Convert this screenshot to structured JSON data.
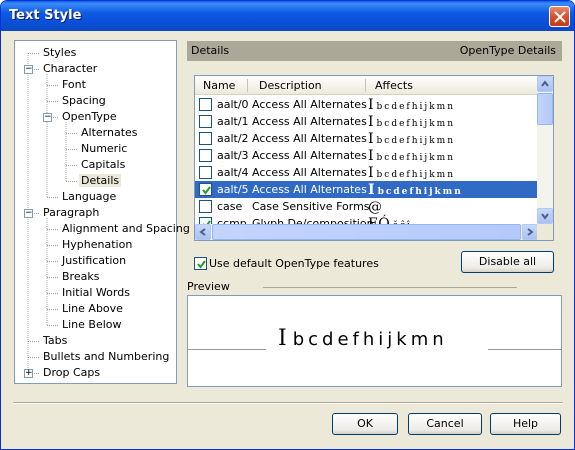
{
  "window": {
    "title": "Text Style"
  },
  "tree": {
    "items": [
      {
        "label": "Styles",
        "level": 0,
        "expander": ""
      },
      {
        "label": "Character",
        "level": 0,
        "expander": "−"
      },
      {
        "label": "Font",
        "level": 1,
        "expander": ""
      },
      {
        "label": "Spacing",
        "level": 1,
        "expander": ""
      },
      {
        "label": "OpenType",
        "level": 1,
        "expander": "−"
      },
      {
        "label": "Alternates",
        "level": 2,
        "expander": ""
      },
      {
        "label": "Numeric",
        "level": 2,
        "expander": ""
      },
      {
        "label": "Capitals",
        "level": 2,
        "expander": ""
      },
      {
        "label": "Details",
        "level": 2,
        "expander": "",
        "selected": true
      },
      {
        "label": "Language",
        "level": 1,
        "expander": ""
      },
      {
        "label": "Paragraph",
        "level": 0,
        "expander": "−"
      },
      {
        "label": "Alignment and Spacing",
        "level": 1,
        "expander": ""
      },
      {
        "label": "Hyphenation",
        "level": 1,
        "expander": ""
      },
      {
        "label": "Justification",
        "level": 1,
        "expander": ""
      },
      {
        "label": "Breaks",
        "level": 1,
        "expander": ""
      },
      {
        "label": "Initial Words",
        "level": 1,
        "expander": ""
      },
      {
        "label": "Line Above",
        "level": 1,
        "expander": ""
      },
      {
        "label": "Line Below",
        "level": 1,
        "expander": ""
      },
      {
        "label": "Tabs",
        "level": 0,
        "expander": ""
      },
      {
        "label": "Bullets and Numbering",
        "level": 0,
        "expander": ""
      },
      {
        "label": "Drop Caps",
        "level": 0,
        "expander": "+"
      }
    ]
  },
  "details": {
    "title": "Details",
    "subtitle": "OpenType Details"
  },
  "list": {
    "columns": [
      "Name",
      "Description",
      "Affects"
    ],
    "rows": [
      {
        "name": "aalt/0",
        "desc": "Access All Alternates",
        "aff_big": "I",
        "aff": "bcdefhijkmn",
        "checked": false,
        "selected": false
      },
      {
        "name": "aalt/1",
        "desc": "Access All Alternates",
        "aff_big": "I",
        "aff": "bcdefhijkmn",
        "checked": false,
        "selected": false
      },
      {
        "name": "aalt/2",
        "desc": "Access All Alternates",
        "aff_big": "I",
        "aff": "bcdefhijkmn",
        "checked": false,
        "selected": false
      },
      {
        "name": "aalt/3",
        "desc": "Access All Alternates",
        "aff_big": "I",
        "aff": "bcdefhijkmn",
        "checked": false,
        "selected": false
      },
      {
        "name": "aalt/4",
        "desc": "Access All Alternates",
        "aff_big": "I",
        "aff": "bcdefhijkmn",
        "checked": false,
        "selected": false
      },
      {
        "name": "aalt/5",
        "desc": "Access All Alternates",
        "aff_big": "I",
        "aff": "bcdefhijkmn",
        "checked": true,
        "selected": true
      },
      {
        "name": "case",
        "desc": "Case Sensitive Forms",
        "aff_big": "@",
        "aff": "",
        "checked": false,
        "selected": false
      },
      {
        "name": "ccmp",
        "desc": "Glyph De/composition",
        "aff_big": "EÓ",
        "aff": "ĕĉĵ",
        "checked": true,
        "selected": false
      }
    ]
  },
  "use_default": {
    "label": "Use default OpenType features",
    "checked": true
  },
  "buttons": {
    "disable_all": "Disable all",
    "ok": "OK",
    "cancel": "Cancel",
    "help": "Help"
  },
  "preview": {
    "label": "Preview",
    "cursor": "I",
    "sample": "bcdefhijkmn"
  }
}
